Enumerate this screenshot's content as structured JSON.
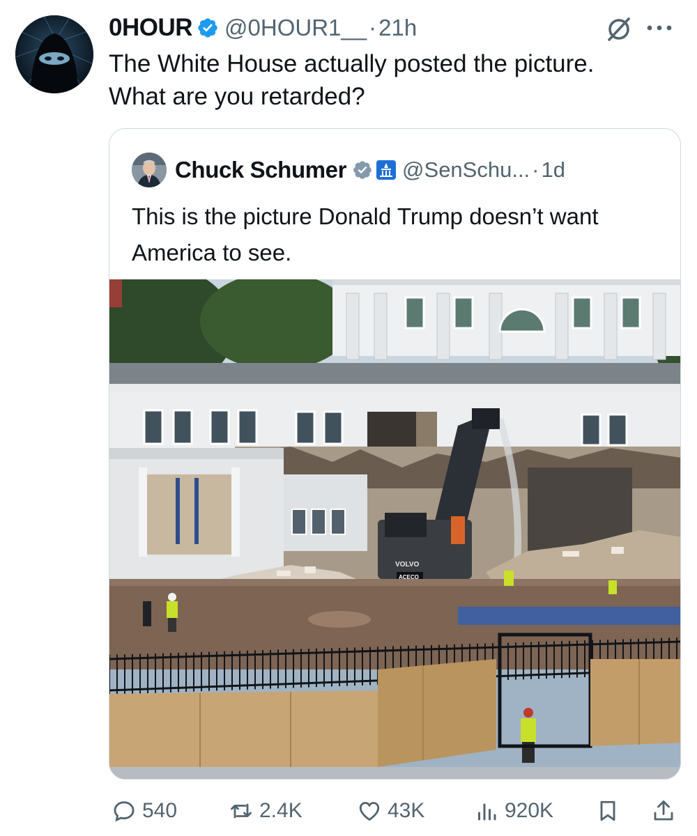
{
  "author": {
    "name": "0HOUR",
    "handle": "@0HOUR1__",
    "time": "21h",
    "avatar_icon": "masked-hacker-avatar",
    "verified_color": "#1d9bf0"
  },
  "tweet": {
    "text": "The White House actually posted the picture.\nWhat are you retarded?"
  },
  "quoted_tweet": {
    "name": "Chuck Schumer",
    "handle": "@SenSchu...",
    "time": "1d",
    "badges": [
      "verified-icon",
      "government-building-icon"
    ],
    "text": "This is the picture Donald Trump doesn’t want America to see.",
    "photo": {
      "excavator_brand": "VOLVO",
      "excavator_plate": "ACECO"
    }
  },
  "actions": {
    "replies": "540",
    "reposts": "2.4K",
    "likes": "43K",
    "views": "920K"
  },
  "colors": {
    "text": "#0f1419",
    "secondary": "#536471",
    "border": "#cfd9de",
    "accent": "#1d9bf0"
  },
  "dot": "·"
}
